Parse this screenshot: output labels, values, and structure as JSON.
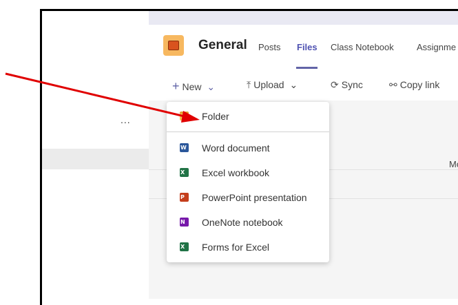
{
  "header": {
    "title": "General"
  },
  "tabs": [
    {
      "label": "Posts",
      "active": false
    },
    {
      "label": "Files",
      "active": true
    },
    {
      "label": "Class Notebook",
      "active": false
    },
    {
      "label": "Assignme",
      "active": false
    }
  ],
  "toolbar": {
    "new_label": "New",
    "upload_label": "Upload",
    "sync_label": "Sync",
    "copy_link_label": "Copy link"
  },
  "sidebar": {
    "more_label": "..."
  },
  "list": {
    "modified_col": "Mo"
  },
  "new_menu": {
    "items": [
      {
        "label": "Folder",
        "icon": "folder-icon"
      },
      {
        "label": "Word document",
        "icon": "word-icon",
        "color": "#2b579a",
        "letter": "W"
      },
      {
        "label": "Excel workbook",
        "icon": "excel-icon",
        "color": "#217346",
        "letter": "X"
      },
      {
        "label": "PowerPoint presentation",
        "icon": "powerpoint-icon",
        "color": "#c43e1c",
        "letter": "P"
      },
      {
        "label": "OneNote notebook",
        "icon": "onenote-icon",
        "color": "#7719aa",
        "letter": "N"
      },
      {
        "label": "Forms for Excel",
        "icon": "forms-for-excel-icon",
        "color": "#217346",
        "letter": "X"
      }
    ]
  },
  "colors": {
    "accent": "#6264a7",
    "annotation": "#e00000"
  }
}
